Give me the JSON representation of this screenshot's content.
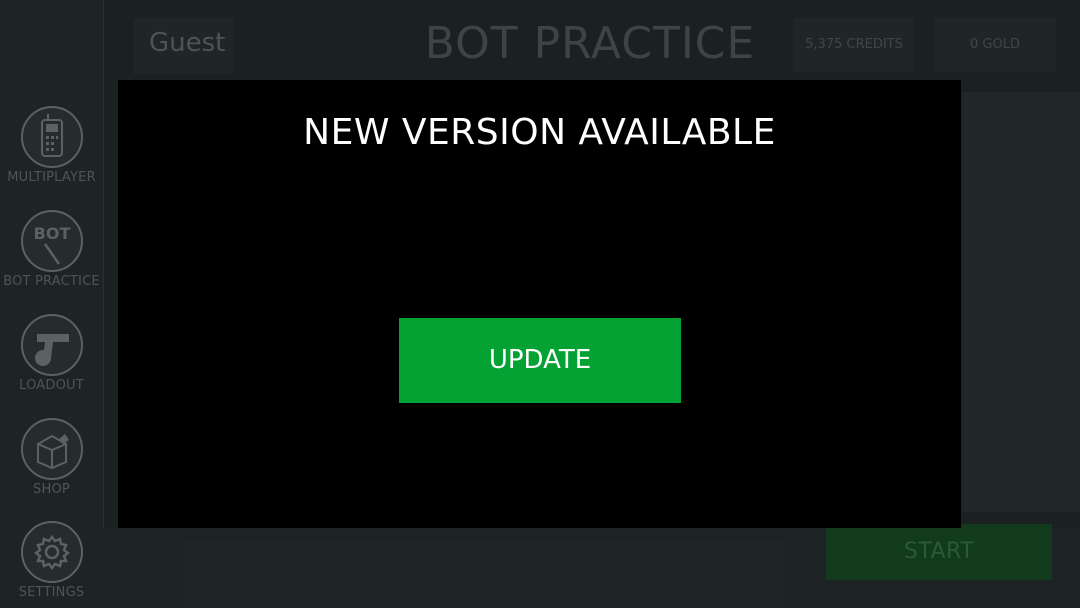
{
  "header": {
    "user_name": "Guest",
    "page_title": "BOT PRACTICE",
    "credits": "5,375 CREDITS",
    "gold": "0 GOLD"
  },
  "sidebar": {
    "items": [
      {
        "label": "MULTIPLAYER",
        "icon": "walkie-talkie-icon"
      },
      {
        "label": "BOT PRACTICE",
        "icon": "bot-icon",
        "icon_text": "BOT"
      },
      {
        "label": "LOADOUT",
        "icon": "pistol-grenade-icon"
      },
      {
        "label": "SHOP",
        "icon": "shop-box-icon"
      },
      {
        "label": "SETTINGS",
        "icon": "gear-icon"
      }
    ]
  },
  "main": {
    "start_label": "START"
  },
  "modal": {
    "title": "NEW VERSION AVAILABLE",
    "update_label": "UPDATE"
  },
  "colors": {
    "update_green": "#04a133",
    "background": "#1b2020",
    "modal_bg": "#000000"
  }
}
